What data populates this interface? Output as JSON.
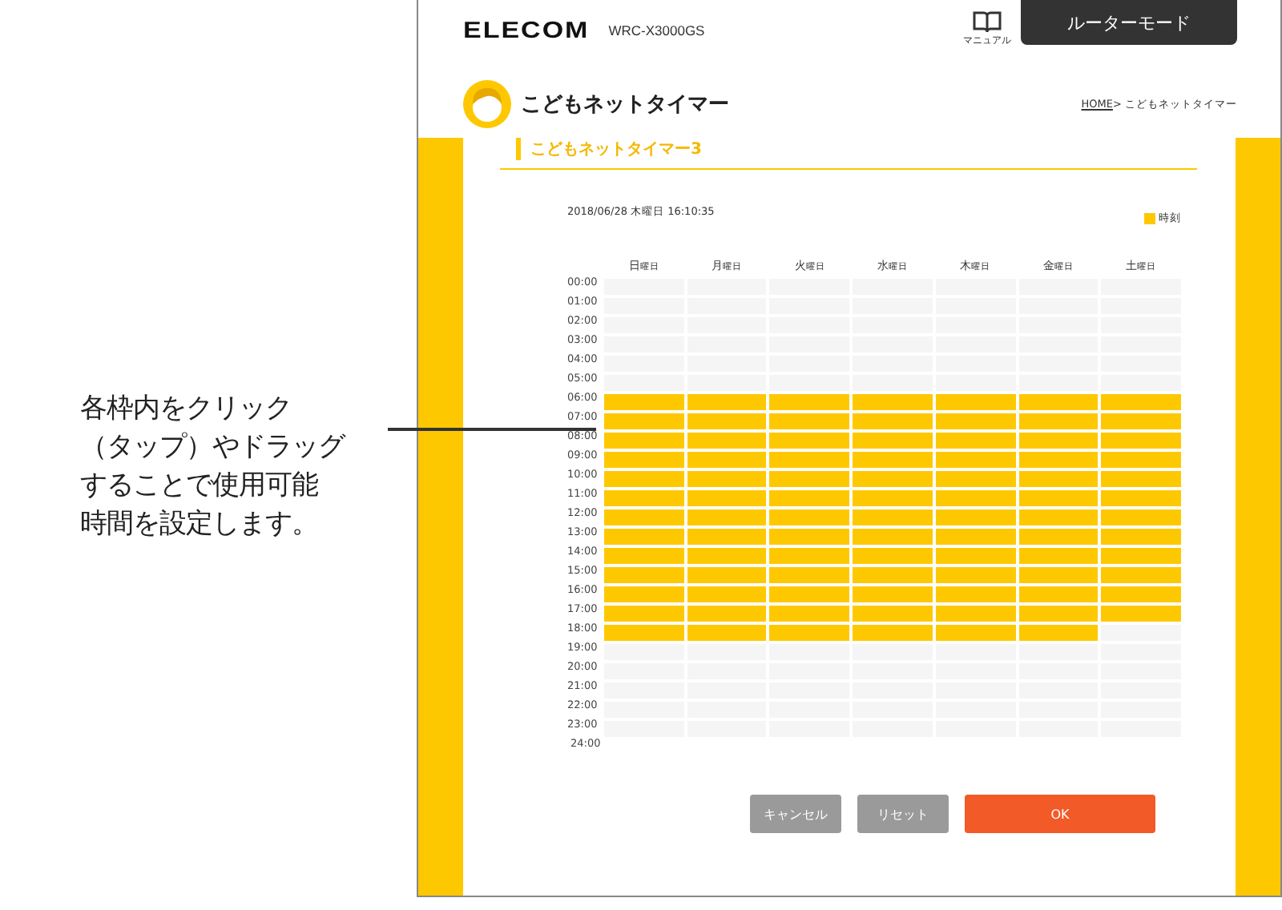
{
  "annotation": {
    "lines": [
      "各枠内をクリック",
      "（タップ）やドラッグ",
      "することで使用可能",
      "時間を設定します。"
    ]
  },
  "header": {
    "logo": "ELECOM",
    "model": "WRC-X3000GS",
    "manual": "マニュアル",
    "mode_tab": "ルーターモード"
  },
  "page": {
    "title": "こどもネットタイマー",
    "breadcrumb_home": "HOME",
    "breadcrumb_rest": " > こどもネットタイマー",
    "subtitle": "こどもネットタイマー3"
  },
  "datetime": "2018/06/28 木曜日 16:10:35",
  "legend": "時刻",
  "days": [
    {
      "main": "日",
      "suffix": "曜日"
    },
    {
      "main": "月",
      "suffix": "曜日"
    },
    {
      "main": "火",
      "suffix": "曜日"
    },
    {
      "main": "水",
      "suffix": "曜日"
    },
    {
      "main": "木",
      "suffix": "曜日"
    },
    {
      "main": "金",
      "suffix": "曜日"
    },
    {
      "main": "土",
      "suffix": "曜日"
    }
  ],
  "hours": [
    {
      "label": "00:00",
      "slots": [
        false,
        false,
        false,
        false,
        false,
        false,
        false
      ]
    },
    {
      "label": "01:00",
      "slots": [
        false,
        false,
        false,
        false,
        false,
        false,
        false
      ]
    },
    {
      "label": "02:00",
      "slots": [
        false,
        false,
        false,
        false,
        false,
        false,
        false
      ]
    },
    {
      "label": "03:00",
      "slots": [
        false,
        false,
        false,
        false,
        false,
        false,
        false
      ]
    },
    {
      "label": "04:00",
      "slots": [
        false,
        false,
        false,
        false,
        false,
        false,
        false
      ]
    },
    {
      "label": "05:00",
      "slots": [
        false,
        false,
        false,
        false,
        false,
        false,
        false
      ]
    },
    {
      "label": "06:00",
      "slots": [
        true,
        true,
        true,
        true,
        true,
        true,
        true
      ]
    },
    {
      "label": "07:00",
      "slots": [
        true,
        true,
        true,
        true,
        true,
        true,
        true
      ]
    },
    {
      "label": "08:00",
      "slots": [
        true,
        true,
        true,
        true,
        true,
        true,
        true
      ]
    },
    {
      "label": "09:00",
      "slots": [
        true,
        true,
        true,
        true,
        true,
        true,
        true
      ]
    },
    {
      "label": "10:00",
      "slots": [
        true,
        true,
        true,
        true,
        true,
        true,
        true
      ]
    },
    {
      "label": "11:00",
      "slots": [
        true,
        true,
        true,
        true,
        true,
        true,
        true
      ]
    },
    {
      "label": "12:00",
      "slots": [
        true,
        true,
        true,
        true,
        true,
        true,
        true
      ]
    },
    {
      "label": "13:00",
      "slots": [
        true,
        true,
        true,
        true,
        true,
        true,
        true
      ]
    },
    {
      "label": "14:00",
      "slots": [
        true,
        true,
        true,
        true,
        true,
        true,
        true
      ]
    },
    {
      "label": "15:00",
      "slots": [
        true,
        true,
        true,
        true,
        true,
        true,
        true
      ]
    },
    {
      "label": "16:00",
      "slots": [
        true,
        true,
        true,
        true,
        true,
        true,
        true
      ]
    },
    {
      "label": "17:00",
      "slots": [
        true,
        true,
        true,
        true,
        true,
        true,
        true
      ]
    },
    {
      "label": "18:00",
      "slots": [
        true,
        true,
        true,
        true,
        true,
        true,
        false
      ]
    },
    {
      "label": "19:00",
      "slots": [
        false,
        false,
        false,
        false,
        false,
        false,
        false
      ]
    },
    {
      "label": "20:00",
      "slots": [
        false,
        false,
        false,
        false,
        false,
        false,
        false
      ]
    },
    {
      "label": "21:00",
      "slots": [
        false,
        false,
        false,
        false,
        false,
        false,
        false
      ]
    },
    {
      "label": "22:00",
      "slots": [
        false,
        false,
        false,
        false,
        false,
        false,
        false
      ]
    },
    {
      "label": "23:00",
      "slots": [
        false,
        false,
        false,
        false,
        false,
        false,
        false
      ]
    }
  ],
  "end_label": "24:00",
  "buttons": [
    {
      "label": "キャンセル",
      "kind": "secondary"
    },
    {
      "label": "リセット",
      "kind": "secondary"
    },
    {
      "label": "OK",
      "kind": "primary"
    }
  ]
}
